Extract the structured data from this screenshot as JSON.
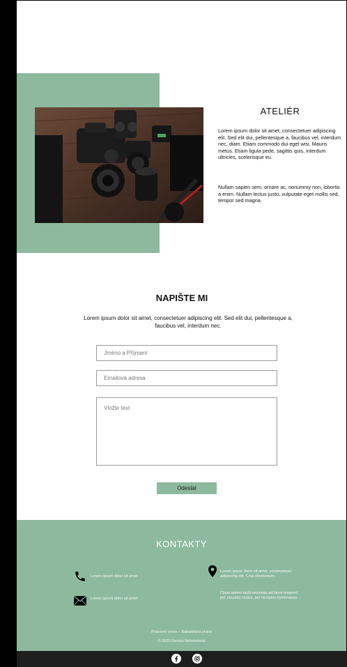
{
  "atelier": {
    "title": "ATELIÉR",
    "paragraph1": "Lorem ipsum dolor sit amet, consectetuer adipiscing elit. Sed elit dui, pellentesque a, faucibus vel, interdum nec, diam. Etiam commodo dui eget wisi. Mauris metus. Etiam ligula pede, sagittis quis, interdum ultricies, scelerisque eu.",
    "paragraph2": "Nullam sapien sem, ornare ac, nonummy non, lobortis a enim. Nullam lectus justo, vulputate eget mollis sed, tempor sed magna."
  },
  "contact_form": {
    "title": "NAPIŠTE MI",
    "lead": "Lorem ipsum dolor sit amet, consectetuer adipiscing elit. Sed elit dui, pellentesque a, faucibus vel, interdum nec.",
    "name_placeholder": "Jméno a Příjmení",
    "email_placeholder": "Emailová adresa",
    "message_placeholder": "Vložte text",
    "submit_label": "Odeslat"
  },
  "footer": {
    "title": "KONTAKTY",
    "phone_text": "Lorem ipsum dolor sit amet",
    "mail_text": "Lorem ipsum dolor sit amet",
    "address_text1": "Lorem ipsum dolor sit amet, consectetuer adipiscing elit. Cras elementum.",
    "address_text2": "Class aptent taciti sociosqu ad litora torquent per conubia nostra, per inceptos hymenaeos",
    "meta_line1": "Pracovní verze – Bakalářská práce",
    "meta_line2": "© 2023 Denisa Nekvindová",
    "icons": [
      "phone-icon",
      "mail-icon",
      "location-pin-icon",
      "facebook-icon",
      "instagram-icon"
    ]
  },
  "colors": {
    "accent_green": "#8dba9e",
    "bottom_bar": "#1e1e1e"
  }
}
